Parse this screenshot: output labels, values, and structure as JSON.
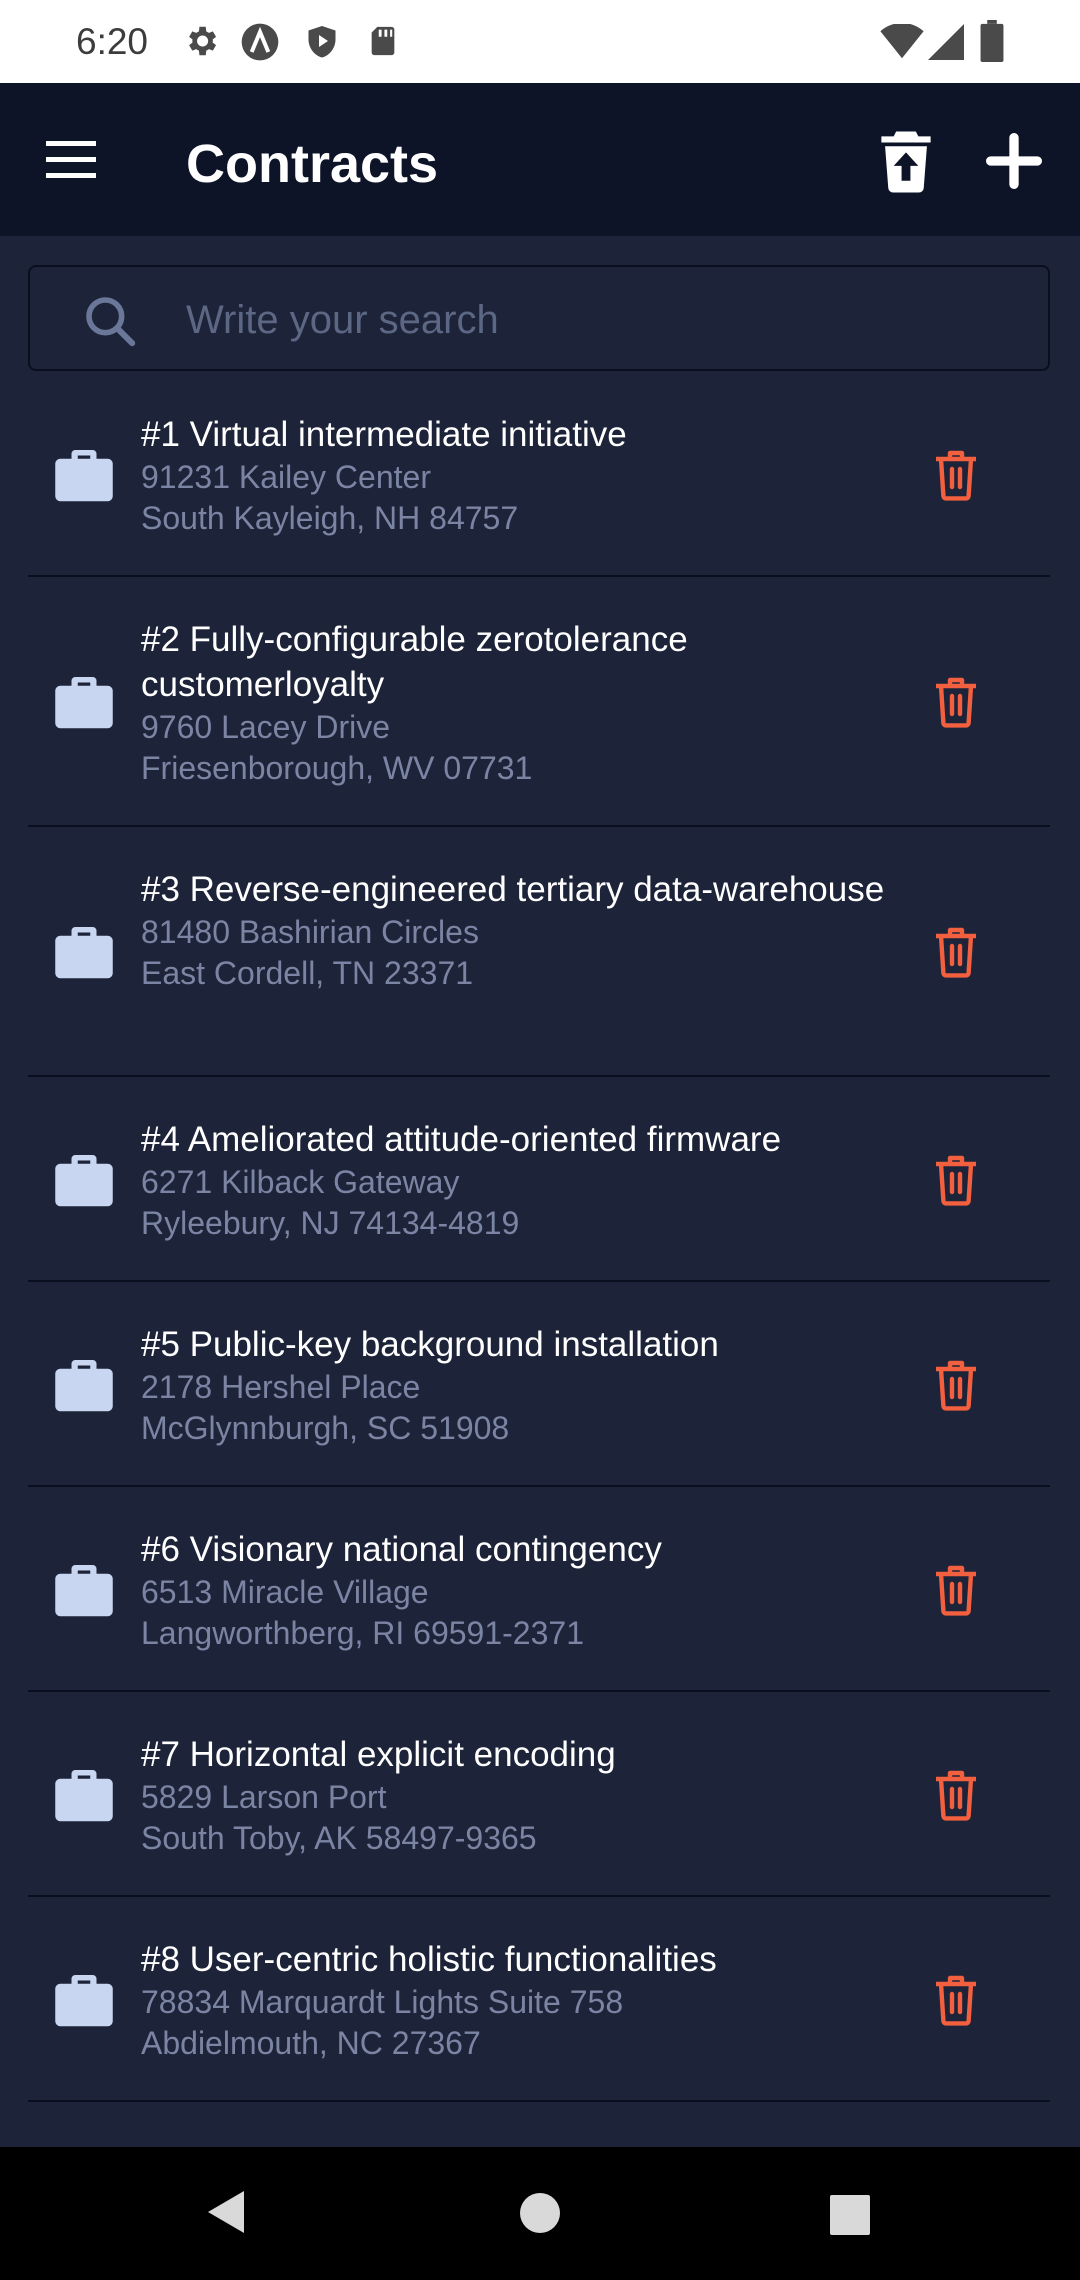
{
  "status_bar": {
    "time": "6:20",
    "icons": [
      "gear-icon",
      "a-circle-icon",
      "shield-icon",
      "sd-card-icon",
      "wifi-icon",
      "signal-icon",
      "battery-icon"
    ]
  },
  "app_bar": {
    "title": "Contracts",
    "icons": [
      "hamburger-menu-icon",
      "trash-upload-icon",
      "plus-icon"
    ]
  },
  "search": {
    "placeholder": "Write your search",
    "value": ""
  },
  "colors": {
    "background": "#1d2338",
    "app_bar": "#0e1428",
    "delete_accent": "#f2603f",
    "item_icon": "#c9d6f2",
    "secondary_text": "#7b85a3"
  },
  "contracts": [
    {
      "title": "#1 Virtual intermediate initiative",
      "street": "91231 Kailey Center",
      "city": "South Kayleigh, NH 84757"
    },
    {
      "title": "#2 Fully-configurable zerotolerance customerloyalty",
      "street": "9760 Lacey Drive",
      "city": "Friesenborough, WV 07731"
    },
    {
      "title": "#3 Reverse-engineered tertiary data-warehouse",
      "street": "81480 Bashirian Circles",
      "city": "East Cordell, TN 23371"
    },
    {
      "title": "#4 Ameliorated attitude-oriented firmware",
      "street": "6271 Kilback Gateway",
      "city": "Ryleebury, NJ 74134-4819"
    },
    {
      "title": "#5 Public-key background installation",
      "street": "2178 Hershel Place",
      "city": "McGlynnburgh, SC 51908"
    },
    {
      "title": "#6 Visionary national contingency",
      "street": "6513 Miracle Village",
      "city": "Langworthberg, RI 69591-2371"
    },
    {
      "title": "#7 Horizontal explicit encoding",
      "street": "5829 Larson Port",
      "city": "South Toby, AK 58497-9365"
    },
    {
      "title": "#8 User-centric holistic functionalities",
      "street": "78834 Marquardt Lights Suite 758",
      "city": "Abdielmouth, NC 27367"
    }
  ],
  "nav_bar": {
    "icons": [
      "back-icon",
      "home-icon",
      "recents-icon"
    ]
  }
}
